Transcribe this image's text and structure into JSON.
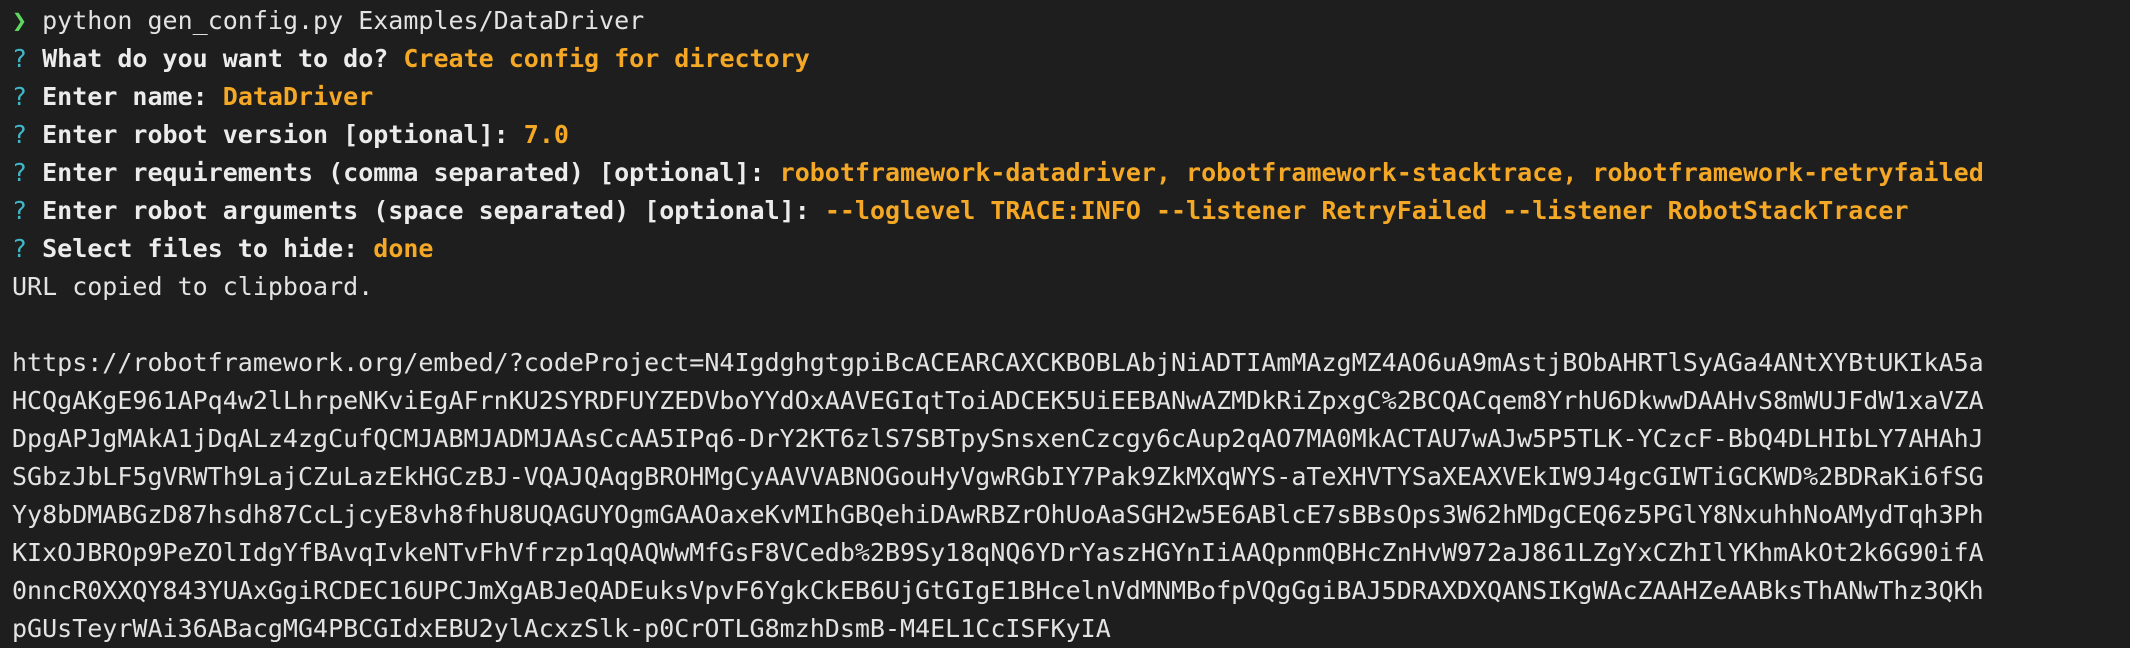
{
  "command": {
    "prompt_symbol": "❯",
    "text": "python gen_config.py Examples/DataDriver"
  },
  "prompts": [
    {
      "mark": "?",
      "question": "What do you want to do?",
      "answer": "Create config for directory"
    },
    {
      "mark": "?",
      "question": "Enter name:",
      "answer": "DataDriver"
    },
    {
      "mark": "?",
      "question": "Enter robot version [optional]:",
      "answer": "7.0"
    },
    {
      "mark": "?",
      "question": "Enter requirements (comma separated) [optional]:",
      "answer": "robotframework-datadriver, robotframework-stacktrace, robotframework-retryfailed"
    },
    {
      "mark": "?",
      "question": "Enter robot arguments (space separated) [optional]:",
      "answer": "--loglevel TRACE:INFO --listener RetryFailed --listener RobotStackTracer"
    },
    {
      "mark": "?",
      "question": "Select files to hide:",
      "answer": "done"
    }
  ],
  "status_message": "URL copied to clipboard.",
  "url_lines": [
    "https://robotframework.org/embed/?codeProject=N4IgdghgtgpiBcACEARCAXCKBOBLAbjNiADTIAmMAzgMZ4AO6uA9mAstjBObAHRTlSyAGa4ANtXYBtUKIkA5a",
    "HCQgAKgE961APq4w2lLhrpeNKviEgAFrnKU2SYRDFUYZEDVboYYdOxAAVEGIqtToiADCEK5UiEEBANwAZMDkRiZpxgC%2BCQACqem8YrhU6DkwwDAAHvS8mWUJFdW1xaVZA",
    "DpgAPJgMAkA1jDqALz4zgCufQCMJABMJADMJAAsCcAA5IPq6-DrY2KT6zlS7SBTpySnsxenCzcgy6cAup2qAO7MA0MkACTAU7wAJw5P5TLK-YCzcF-BbQ4DLHIbLY7AHAhJ",
    "SGbzJbLF5gVRWTh9LajCZuLazEkHGCzBJ-VQAJQAqgBROHMgCyAAVVABNOGouHyVgwRGbIY7Pak9ZkMXqWYS-aTeXHVTYSaXEAXVEkIW9J4gcGIWTiGCKWD%2BDRaKi6fSG",
    "Yy8bDMABGzD87hsdh87CcLjcyE8vh8fhU8UQAGUYOgmGAAOaxeKvMIhGBQehiDAwRBZrOhUoAaSGH2w5E6ABlcE7sBBsOps3W62hMDgCEQ6z5PGlY8NxuhhNoAMydTqh3Ph",
    "KIxOJBROp9PeZOlIdgYfBAvqIvkeNTvFhVfrzp1qQAQWwMfGsF8VCedb%2B9Sy18qNQ6YDrYaszHGYnIiAAQpnmQBHcZnHvW972aJ861LZgYxCZhIlYKhmAkOt2k6G90ifA",
    "0nncR0XXQY843YUAxGgiRCDEC16UPCJmXgABJeQADEuksVpvF6YgkCkEB6UjGtGIgE1BHcelnVdMNMBofpVQgGgiBAJ5DRAXDXQANSIKgWAcZAAHZeAABksThANwThz3QKh",
    "pGUsTeyrWAi36ABacgMG4PBCGIdxEBU2ylAcxzSlk-p0CrOTLG8mzhDsmB-M4EL1CcISFKyIA"
  ]
}
